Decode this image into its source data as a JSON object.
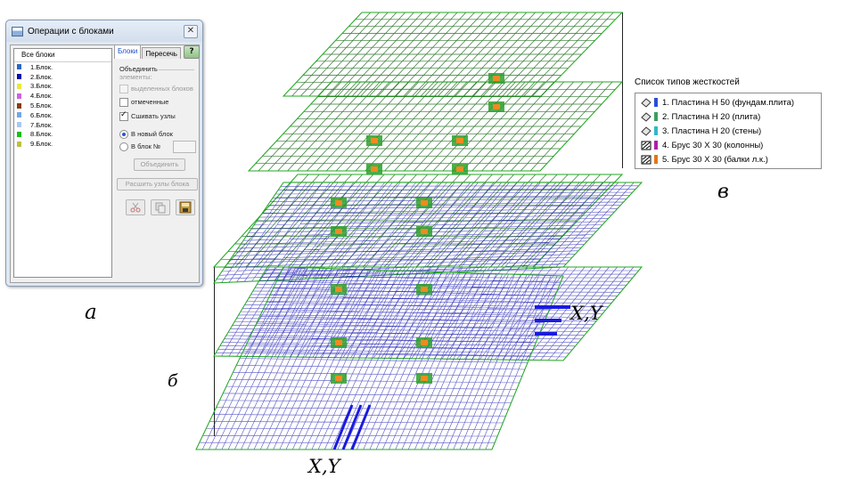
{
  "dialog": {
    "title": "Операции с блоками",
    "close": "✕",
    "list_header": "Все блоки",
    "blocks": [
      {
        "label": "1.Блок.",
        "color": "#2a68c4"
      },
      {
        "label": "2.Блок.",
        "color": "#0a0aa8"
      },
      {
        "label": "3.Блок.",
        "color": "#e8e83a"
      },
      {
        "label": "4.Блок.",
        "color": "#d060e0"
      },
      {
        "label": "5.Блок.",
        "color": "#8a3c10"
      },
      {
        "label": "6.Блок.",
        "color": "#70a8e8"
      },
      {
        "label": "7.Блок.",
        "color": "#a8c8f0"
      },
      {
        "label": "8.Блок.",
        "color": "#18c018"
      },
      {
        "label": "9.Блок.",
        "color": "#c0c040"
      }
    ],
    "tabs": [
      "Блоки",
      "Пересечь"
    ],
    "help": "?",
    "merge_label_1": "Объединить",
    "merge_label_2": "элементы:",
    "cb_selected": "выделенных блоков",
    "cb_marked": "отмеченные",
    "cb_stitch": "Сшивать узлы",
    "rb_new_block": "В новый блок",
    "rb_block_no": "В блок №",
    "btn_merge": "Объединить",
    "btn_split": "Расшить узлы блока"
  },
  "captions": {
    "a": "а",
    "b": "б",
    "v": "в",
    "xy_right": "X,Y",
    "xy_bottom": "X,Y"
  },
  "legend": {
    "title": "Список типов жесткостей",
    "items": [
      {
        "label": "1. Пластина  H 50 (фундам.плита)",
        "color": "#2a4fd8",
        "icon": "plate-icon"
      },
      {
        "label": "2. Пластина  H 20 (плита)",
        "color": "#3aa060",
        "icon": "plate-icon"
      },
      {
        "label": "3. Пластина  H 20 (стены)",
        "color": "#30b8c8",
        "icon": "plate-icon"
      },
      {
        "label": "4. Брус 30 X 30 (колонны)",
        "color": "#b020a8",
        "icon": "bar-icon"
      },
      {
        "label": "5. Брус 30 X 30 (балки л.к.)",
        "color": "#e07818",
        "icon": "bar-icon"
      }
    ]
  }
}
